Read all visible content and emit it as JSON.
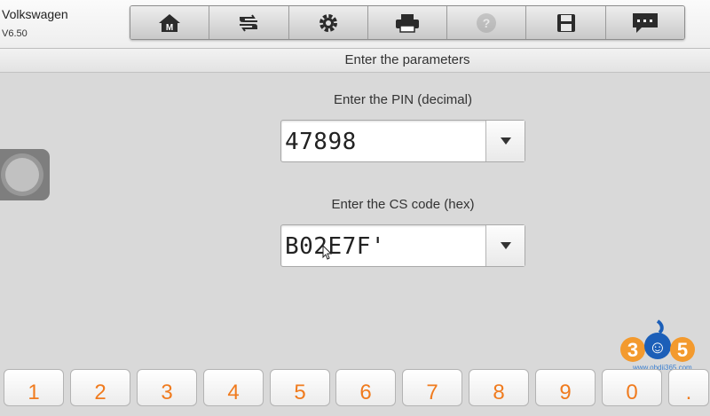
{
  "app": {
    "name": "Volkswagen",
    "version": "V6.50"
  },
  "toolbar": [
    {
      "icon": "home-icon",
      "enabled": true
    },
    {
      "icon": "vehicle-swap-icon",
      "enabled": true
    },
    {
      "icon": "gear-icon",
      "enabled": true
    },
    {
      "icon": "printer-icon",
      "enabled": true
    },
    {
      "icon": "help-icon",
      "enabled": false
    },
    {
      "icon": "save-icon",
      "enabled": true
    },
    {
      "icon": "message-icon",
      "enabled": true
    }
  ],
  "page": {
    "title": "Enter the parameters"
  },
  "pin": {
    "label": "Enter the PIN (decimal)",
    "value": "47898"
  },
  "cs": {
    "label": "Enter the CS code (hex)",
    "value": "B02E7F'"
  },
  "keypad": [
    "1",
    "2",
    "3",
    "4",
    "5",
    "6",
    "7",
    "8",
    "9",
    "0",
    "."
  ],
  "watermark": {
    "brand": "365",
    "url": "www.obdii365.com"
  },
  "colors": {
    "key_text": "#f07b1e",
    "background": "#d9d9d9"
  }
}
